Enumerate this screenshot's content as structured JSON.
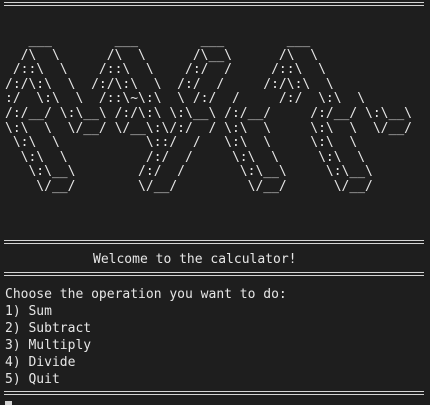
{
  "terminal": {
    "ascii_art": "   ___        ___        ___        ___\n  /\\  \\      /\\  \\      /\\__\\      /\\  \\\n /::\\  \\    /::\\  \\    /:/  /     /::\\  \\\n/:/\\:\\  \\  /:/\\:\\  \\  /:/  /     /:/\\:\\  \\\n:/  \\:\\  \\  /::\\~\\:\\  \\ /:/  /     /:/  \\:\\  \\\n/:/__/ \\:\\__\\ /:/\\:\\ \\:\\__\\ /:/__/     /:/__/ \\:\\__\\\n\\:\\  \\  \\/__/ \\/__\\:\\/:/  / \\:\\  \\     \\:\\  \\  \\/__/\n \\:\\  \\           \\::/  /   \\:\\  \\     \\:\\  \\\n  \\:\\  \\          /:/  /     \\:\\  \\     \\:\\  \\\n   \\:\\__\\        /:/  /       \\:\\__\\     \\:\\__\\\n    \\/__/        \\/__/         \\/__/      \\/__/",
    "welcome": "Welcome to the calculator!",
    "prompt": "Choose the operation you want to do:",
    "options": [
      "1) Sum",
      "2) Subtract",
      "3) Multiply",
      "4) Divide",
      "5) Quit"
    ]
  }
}
